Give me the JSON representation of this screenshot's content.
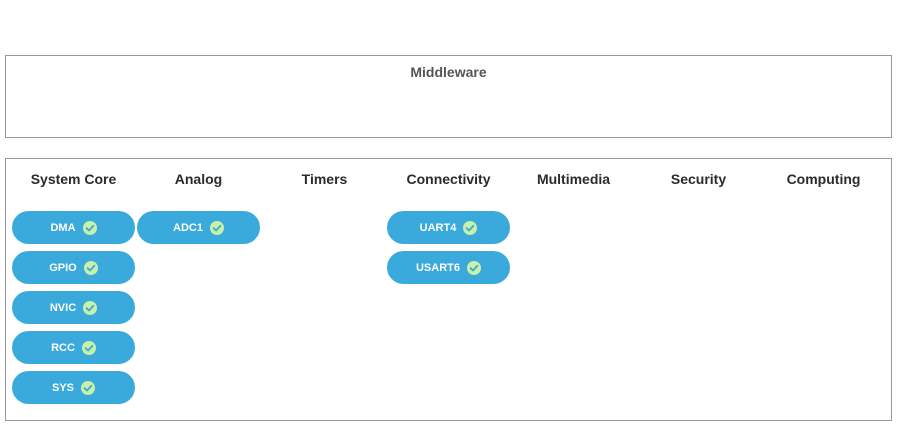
{
  "middleware": {
    "title": "Middleware"
  },
  "categories": {
    "headers": [
      "System Core",
      "Analog",
      "Timers",
      "Connectivity",
      "Multimedia",
      "Security",
      "Computing"
    ],
    "system_core": [
      "DMA",
      "GPIO",
      "NVIC",
      "RCC",
      "SYS"
    ],
    "analog": [
      "ADC1"
    ],
    "connectivity": [
      "UART4",
      "USART6"
    ]
  },
  "colors": {
    "chip": "#3aa9dc",
    "check_fill": "#c8f0a8",
    "check_mark": "#3aa9dc"
  },
  "icons": {
    "chip_status": "check-circle-icon"
  }
}
